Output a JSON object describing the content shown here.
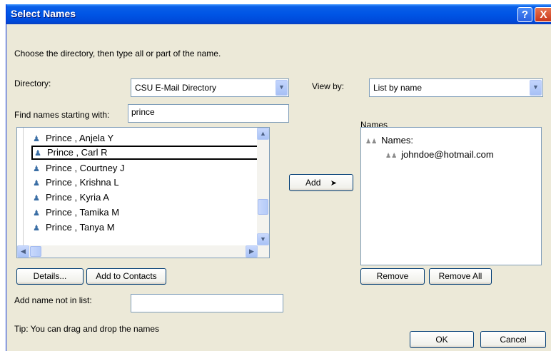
{
  "window": {
    "title": "Select Names",
    "help_label": "?",
    "close_label": "X"
  },
  "instructions": "Choose the directory, then type all or part of the name.",
  "directory": {
    "label": "Directory:",
    "value": "CSU E-Mail Directory"
  },
  "find": {
    "label": "Find names starting with:",
    "value": "prince"
  },
  "view_by": {
    "label": "View by:",
    "value": "List by name"
  },
  "results": {
    "items": [
      {
        "icon": "person-icon",
        "name": "Prince , Anjela Y",
        "selected": false
      },
      {
        "icon": "person-icon",
        "name": "Prince , Carl R",
        "selected": true
      },
      {
        "icon": "person-icon",
        "name": "Prince , Courtney J",
        "selected": false
      },
      {
        "icon": "person-icon",
        "name": "Prince , Krishna L",
        "selected": false
      },
      {
        "icon": "person-icon",
        "name": "Prince , Kyria A",
        "selected": false
      },
      {
        "icon": "person-icon",
        "name": "Prince , Tamika M",
        "selected": false
      },
      {
        "icon": "person-icon",
        "name": "Prince , Tanya M",
        "selected": false
      }
    ]
  },
  "buttons": {
    "add": "Add",
    "details": "Details...",
    "add_to_contacts": "Add to Contacts",
    "remove": "Remove",
    "remove_all": "Remove All",
    "ok": "OK",
    "cancel": "Cancel"
  },
  "names_panel": {
    "label": "Names",
    "group_label": "Names:",
    "members": [
      "johndoe@hotmail.com"
    ]
  },
  "add_not_in_list": {
    "label": "Add name not in list:",
    "value": ""
  },
  "tip": "Tip: You can drag and drop the names",
  "colors": {
    "titlebar": "#0055E5",
    "dialog_bg": "#ECE9D8",
    "input_border": "#7F9DB9"
  }
}
